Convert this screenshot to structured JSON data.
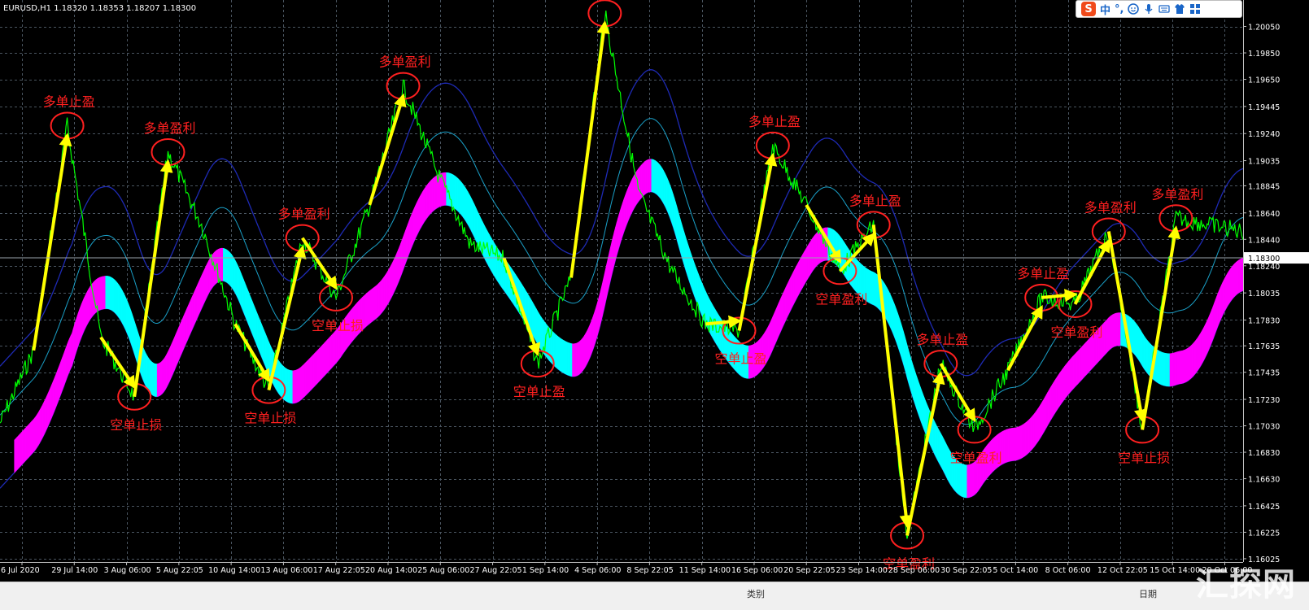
{
  "window": {
    "symbol_line": "EURUSD,H1  1.18320 1.18353 1.18207 1.18300"
  },
  "ime_toolbar": {
    "logo": "S",
    "lang": "中",
    "punct": "°,"
  },
  "status_bar": {
    "label_1": "类别",
    "label_2": "日期"
  },
  "watermark": "汇探网",
  "colors": {
    "background": "#000000",
    "grid": "#4a5560",
    "price_line": "#00ff00",
    "band_up": "#ff00ff",
    "band_down": "#00ffff",
    "channel": "#1e2ab4",
    "middle_line": "#1aa0c8",
    "annotation": "#ff2020",
    "arrow": "#ffff00",
    "current_price_bg": "#ffffff"
  },
  "chart_data": {
    "type": "line",
    "title": "EURUSD,H1  1.18320 1.18353 1.18207 1.18300",
    "ylim": [
      1.16,
      1.2025
    ],
    "current_price": "1.18300",
    "y_ticks": [
      "1.20050",
      "1.19850",
      "1.19650",
      "1.19445",
      "1.19240",
      "1.19035",
      "1.18845",
      "1.18640",
      "1.18440",
      "1.18240",
      "1.18035",
      "1.17830",
      "1.17635",
      "1.17435",
      "1.17230",
      "1.17030",
      "1.16830",
      "1.16630",
      "1.16425",
      "1.16225",
      "1.16025"
    ],
    "x_ticks": [
      "6 Jul 2020",
      "29 Jul 14:00",
      "3 Aug 06:00",
      "5 Aug 22:05",
      "10 Aug 14:00",
      "13 Aug 06:00",
      "17 Aug 22:05",
      "20 Aug 14:00",
      "25 Aug 06:00",
      "27 Aug 22:05",
      "1 Sep 14:00",
      "4 Sep 06:00",
      "8 Sep 22:05",
      "11 Sep 14:00",
      "16 Sep 06:00",
      "20 Sep 22:05",
      "23 Sep 14:00",
      "28 Sep 06:00",
      "30 Sep 22:05",
      "5 Oct 14:00",
      "8 Oct 06:00",
      "12 Oct 22:05",
      "15 Oct 14:00",
      "20 Oct 06:00"
    ],
    "series": [
      {
        "values": [
          1.1705,
          1.176,
          1.193,
          1.177,
          1.1725,
          1.191,
          1.1855,
          1.178,
          1.173,
          1.1845,
          1.18,
          1.187,
          1.196,
          1.1895,
          1.184,
          1.183,
          1.175,
          1.1815,
          1.2015,
          1.188,
          1.182,
          1.178,
          1.1775,
          1.1915,
          1.187,
          1.182,
          1.1855,
          1.162,
          1.175,
          1.17,
          1.1745,
          1.18,
          1.1795,
          1.185,
          1.17,
          1.186,
          1.1855,
          1.185
        ]
      }
    ],
    "annotations": [
      {
        "text": "多单止盈",
        "kind": "long"
      },
      {
        "text": "多单盈利",
        "kind": "long"
      },
      {
        "text": "多单盈利",
        "kind": "long"
      },
      {
        "text": "多单盈利",
        "kind": "long"
      },
      {
        "text": "多单盈利",
        "kind": "long"
      },
      {
        "text": "多单止盈",
        "kind": "long"
      },
      {
        "text": "多单止盈",
        "kind": "long"
      },
      {
        "text": "多单止盈",
        "kind": "long"
      },
      {
        "text": "空单止损",
        "kind": "short"
      },
      {
        "text": "空单止损",
        "kind": "short"
      },
      {
        "text": "空单止损",
        "kind": "short"
      },
      {
        "text": "空单止盈",
        "kind": "short"
      },
      {
        "text": "空单止盈",
        "kind": "short"
      },
      {
        "text": "空单盈利",
        "kind": "short"
      },
      {
        "text": "空单盈利",
        "kind": "short"
      },
      {
        "text": "空单盈利",
        "kind": "short"
      },
      {
        "text": "空单盈利",
        "kind": "short"
      }
    ]
  }
}
